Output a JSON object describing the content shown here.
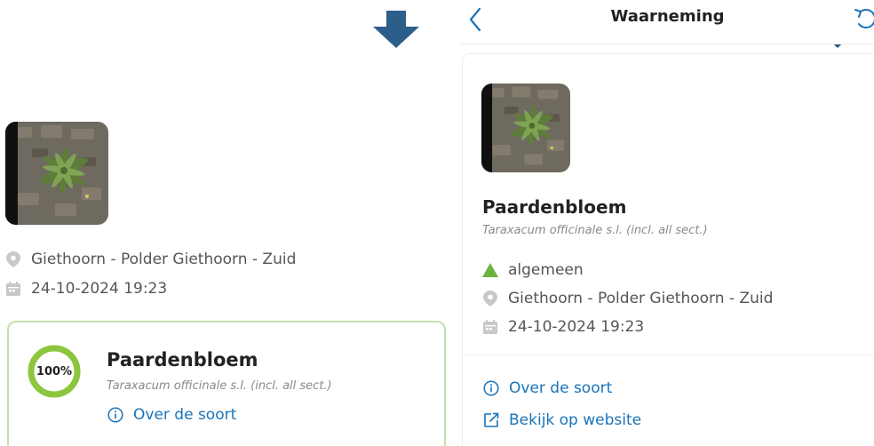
{
  "colors": {
    "hint_arrow": "#2b5f8a",
    "accent_blue": "#1a73b8",
    "ring_green": "#8cc63f",
    "card_border": "#c5e0a8",
    "rarity_green": "#6cb33f",
    "meta_icon": "#c8c8c8"
  },
  "overlay": {
    "hint_arrow_icon": "down-arrow-icon"
  },
  "left_panel": {
    "location": {
      "icon": "map-pin-icon",
      "text": "Giethoorn - Polder Giethoorn - Zuid"
    },
    "datetime": {
      "icon": "calendar-icon",
      "text": "24-10-2024 19:23"
    },
    "result_card": {
      "confidence": 1.0,
      "confidence_label": "100%",
      "name": "Paardenbloem",
      "scientific_name": "Taraxacum officinale s.l. (incl. all sect.)",
      "about_link": {
        "icon": "info-icon",
        "label": "Over de soort"
      }
    }
  },
  "right_panel": {
    "header": {
      "back_icon": "chevron-left-icon",
      "title": "Waarneming",
      "refresh_icon": "refresh-icon"
    },
    "detail": {
      "name": "Paardenbloem",
      "scientific_name": "Taraxacum officinale s.l. (incl. all sect.)",
      "rarity": {
        "icon": "triangle-icon",
        "text": "algemeen"
      },
      "location": {
        "icon": "map-pin-icon",
        "text": "Giethoorn - Polder Giethoorn - Zuid"
      },
      "datetime": {
        "icon": "calendar-icon",
        "text": "24-10-2024 19:23"
      },
      "links": [
        {
          "icon": "info-icon",
          "label": "Over de soort"
        },
        {
          "icon": "external-link-icon",
          "label": "Bekijk op website"
        }
      ]
    }
  }
}
